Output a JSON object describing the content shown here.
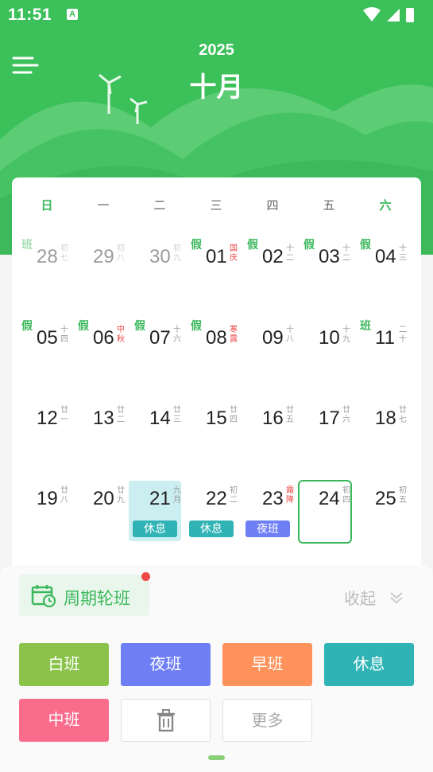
{
  "status_bar": {
    "time": "11:51",
    "notification_icon": "A"
  },
  "header": {
    "year": "2025",
    "month": "十月"
  },
  "colors": {
    "primary": "#3cc05a",
    "white_shift": "#8bc34a",
    "night_shift": "#6e7ff5",
    "early_shift": "#ff915a",
    "rest": "#2fb3b5",
    "mid_shift": "#fb6b8c",
    "holiday_red": "#ee4444"
  },
  "weekdays": [
    "日",
    "一",
    "二",
    "三",
    "四",
    "五",
    "六"
  ],
  "calendar": {
    "weeks": [
      [
        {
          "day": "28",
          "lunar": "初七",
          "tag": "班",
          "faded": true
        },
        {
          "day": "29",
          "lunar": "初八",
          "faded": true
        },
        {
          "day": "30",
          "lunar": "初九",
          "faded": true
        },
        {
          "day": "01",
          "lunar": "国庆",
          "tag": "假",
          "red": true
        },
        {
          "day": "02",
          "lunar": "十二",
          "tag": "假"
        },
        {
          "day": "03",
          "lunar": "十二",
          "tag": "假"
        },
        {
          "day": "04",
          "lunar": "十三",
          "tag": "假"
        }
      ],
      [
        {
          "day": "05",
          "lunar": "十四",
          "tag": "假"
        },
        {
          "day": "06",
          "lunar": "中秋",
          "tag": "假",
          "red": true
        },
        {
          "day": "07",
          "lunar": "十六",
          "tag": "假"
        },
        {
          "day": "08",
          "lunar": "寒露",
          "tag": "假",
          "red": true
        },
        {
          "day": "09",
          "lunar": "十八"
        },
        {
          "day": "10",
          "lunar": "十九"
        },
        {
          "day": "11",
          "lunar": "二十",
          "tag": "班"
        }
      ],
      [
        {
          "day": "12",
          "lunar": "廿一"
        },
        {
          "day": "13",
          "lunar": "廿二"
        },
        {
          "day": "14",
          "lunar": "廿三"
        },
        {
          "day": "15",
          "lunar": "廿四"
        },
        {
          "day": "16",
          "lunar": "廿五"
        },
        {
          "day": "17",
          "lunar": "廿六"
        },
        {
          "day": "18",
          "lunar": "廿七"
        }
      ],
      [
        {
          "day": "19",
          "lunar": "廿八"
        },
        {
          "day": "20",
          "lunar": "廿九"
        },
        {
          "day": "21",
          "lunar": "九月",
          "selected": true,
          "shift": "休息",
          "shift_color": "#2fb3b5"
        },
        {
          "day": "22",
          "lunar": "初二",
          "shift": "休息",
          "shift_color": "#2fb3b5"
        },
        {
          "day": "23",
          "lunar": "霜降",
          "red": true,
          "shift": "夜班",
          "shift_color": "#6e7ff5"
        },
        {
          "day": "24",
          "lunar": "初四",
          "today": true
        },
        {
          "day": "25",
          "lunar": "初五"
        }
      ]
    ]
  },
  "panel": {
    "cycle_label": "周期轮班",
    "collapse_label": "收起",
    "buttons": [
      {
        "label": "白班",
        "color": "#8bc34a"
      },
      {
        "label": "夜班",
        "color": "#6e7ff5"
      },
      {
        "label": "早班",
        "color": "#ff915a"
      },
      {
        "label": "休息",
        "color": "#2fb3b5"
      },
      {
        "label": "中班",
        "color": "#fb6b8c"
      },
      {
        "label": "",
        "icon": "trash-icon"
      },
      {
        "label": "更多"
      }
    ]
  }
}
